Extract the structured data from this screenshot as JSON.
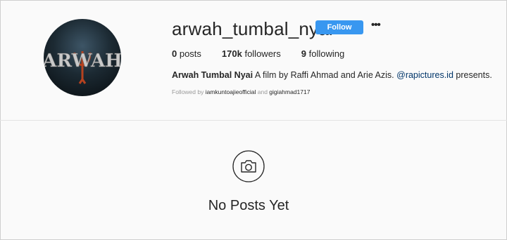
{
  "profile": {
    "username": "arwah_tumbal_nyai",
    "follow_label": "Follow",
    "more_label": "•••",
    "avatar_text": "ARWAH",
    "posts_count": "0",
    "posts_label": " posts",
    "followers_count": "170k",
    "followers_label": " followers",
    "following_count": "9",
    "following_label": " following",
    "bio_name": "Arwah Tumbal Nyai",
    "bio_text": " A film by Raffi Ahmad and Arie Azis. ",
    "bio_mention": "@rapictures.id",
    "bio_end": " presents.",
    "followed_by_prefix": "Followed by ",
    "followed_by_1": "iamkuntoajieofficial",
    "followed_by_and": " and ",
    "followed_by_2": "gigiahmad1717"
  },
  "empty_state": {
    "icon": "camera-icon",
    "title": "No Posts Yet"
  },
  "colors": {
    "follow_button": "#3897f0",
    "mention": "#003569",
    "background": "#fafafa"
  }
}
